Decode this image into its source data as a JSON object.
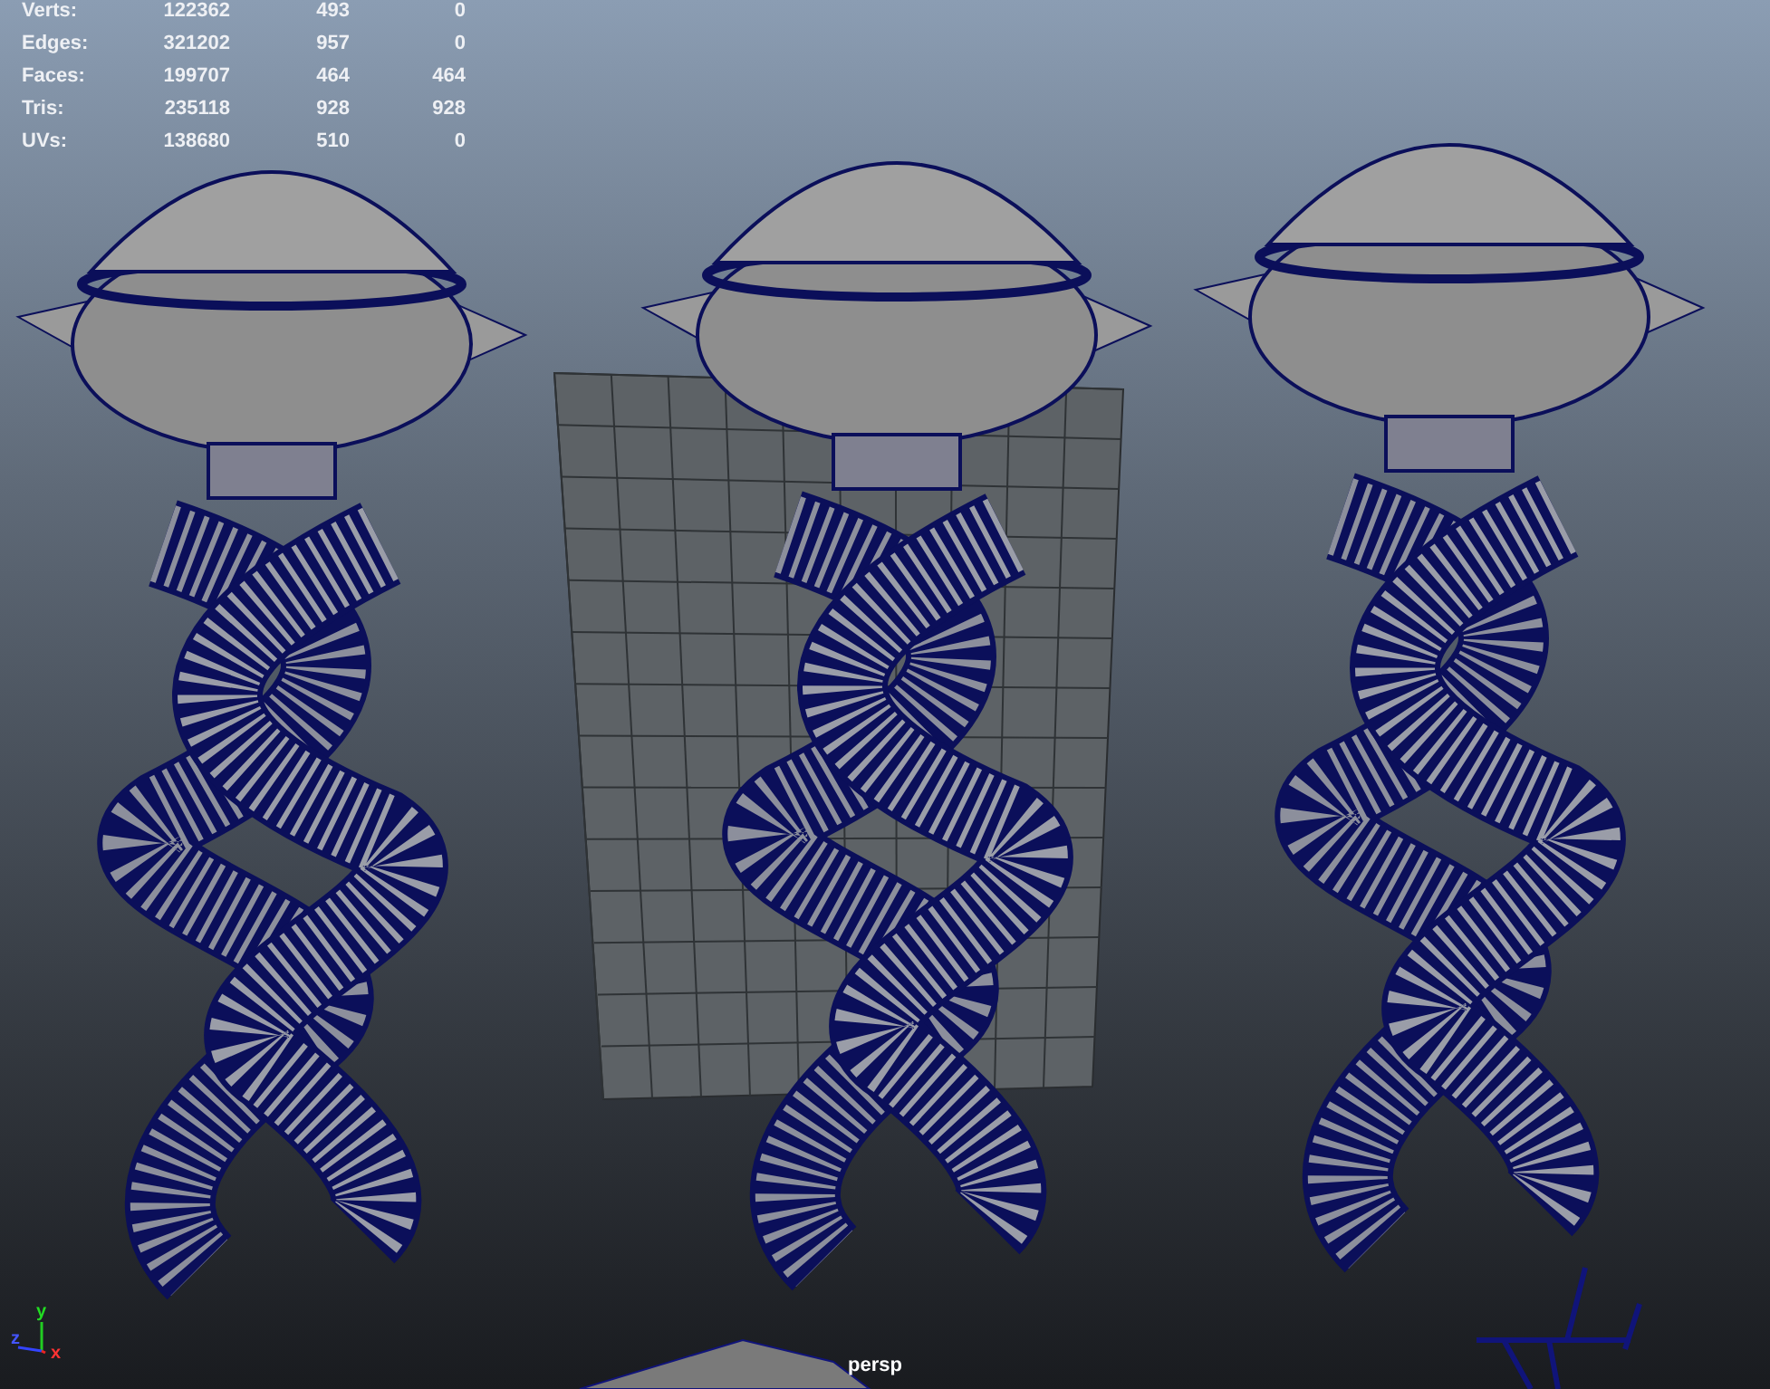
{
  "hud": {
    "rows": [
      {
        "label": "Verts:",
        "values": [
          "122362",
          "493",
          "0"
        ]
      },
      {
        "label": "Edges:",
        "values": [
          "321202",
          "957",
          "0"
        ]
      },
      {
        "label": "Faces:",
        "values": [
          "199707",
          "464",
          "464"
        ]
      },
      {
        "label": "Tris:",
        "values": [
          "235118",
          "928",
          "928"
        ]
      },
      {
        "label": "UVs:",
        "values": [
          "138680",
          "510",
          "0"
        ]
      }
    ]
  },
  "axis": {
    "y": "y",
    "z": "z",
    "x": "x"
  },
  "camera_label": "persp"
}
